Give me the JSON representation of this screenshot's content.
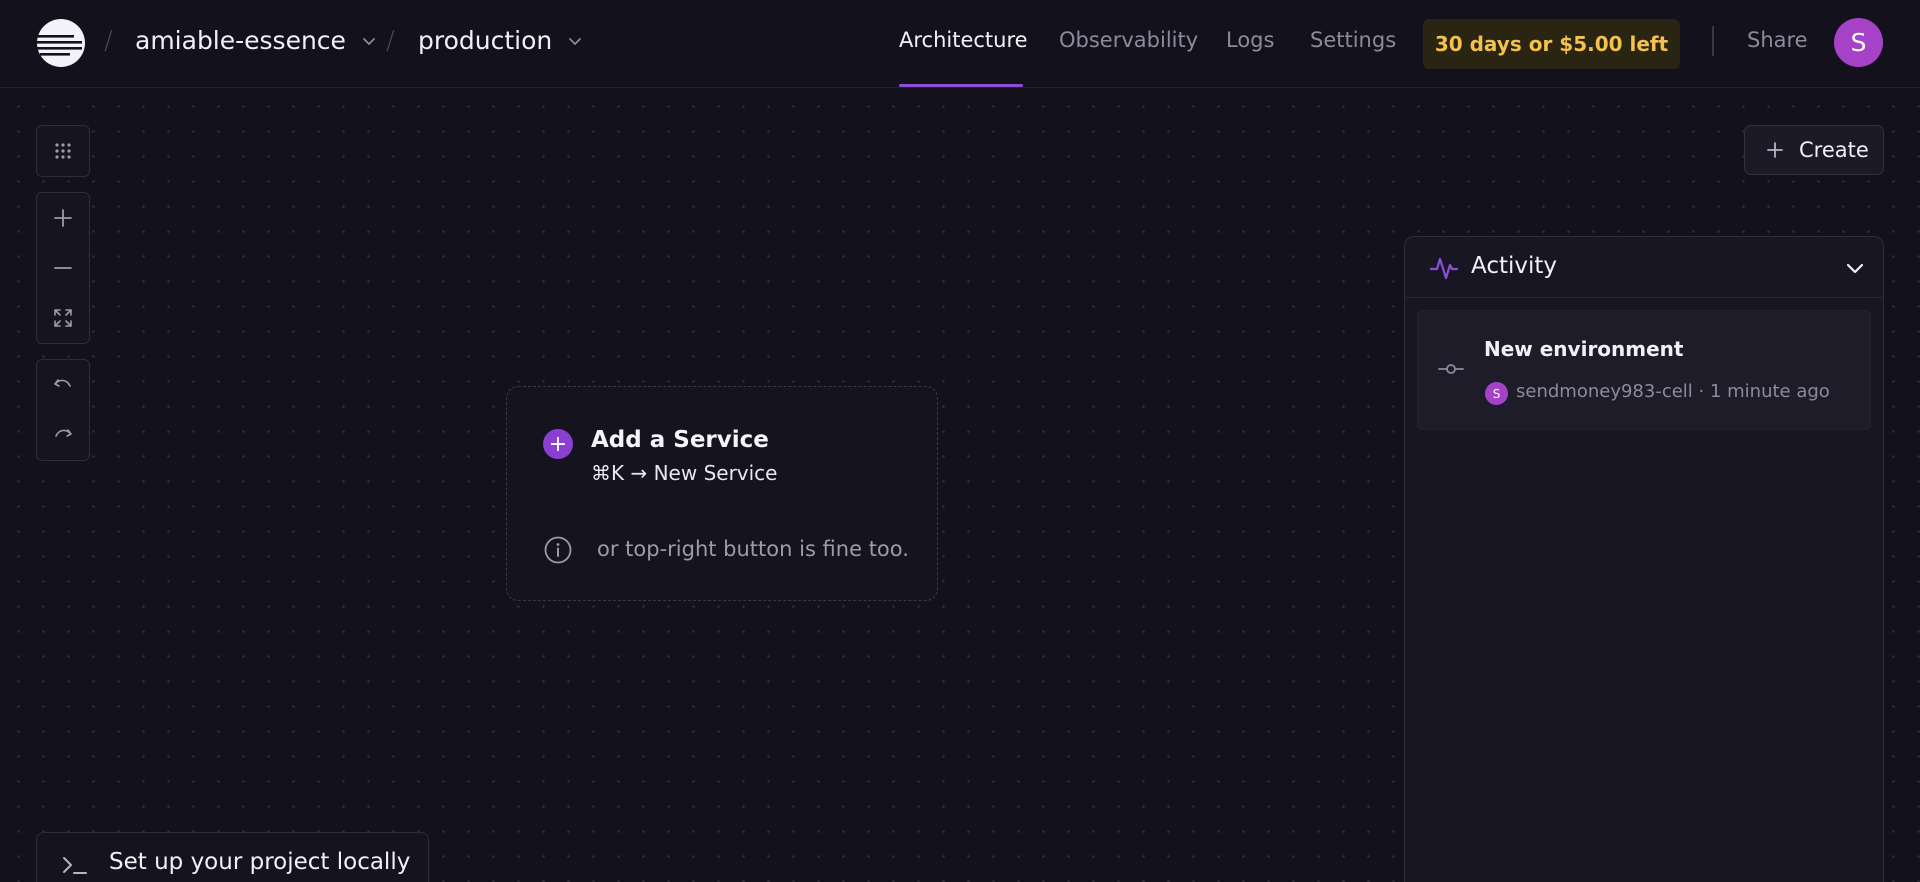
{
  "header": {
    "project": "amiable-essence",
    "environment": "production",
    "nav": {
      "architecture": "Architecture",
      "observability": "Observability",
      "logs": "Logs",
      "settings": "Settings"
    },
    "trial": "30 days or $5.00 left",
    "share": "Share",
    "avatar_initial": "S"
  },
  "canvas": {
    "create_label": "Create",
    "add_service": {
      "title": "Add a Service",
      "shortcut": "⌘K → New Service",
      "hint": "or top-right button is fine too."
    },
    "local_setup_label": "Set up your project locally"
  },
  "activity": {
    "title": "Activity",
    "items": [
      {
        "title": "New environment",
        "avatar_initial": "S",
        "meta": "sendmoney983-cell · 1 minute ago"
      }
    ]
  },
  "colors": {
    "background": "#13111c",
    "accent": "#8a4fd6",
    "trial_text": "#f2c14e",
    "avatar": "#a542c7"
  },
  "icons": [
    "railway-logo-icon",
    "chevron-down-icon",
    "grid-icon",
    "zoom-in-icon",
    "zoom-out-icon",
    "fit-view-icon",
    "undo-icon",
    "redo-icon",
    "plus-icon",
    "info-icon",
    "activity-pulse-icon",
    "commit-icon",
    "terminal-icon"
  ]
}
